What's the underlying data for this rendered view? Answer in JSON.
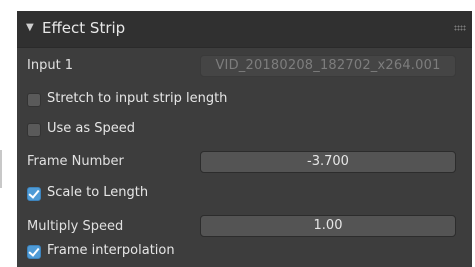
{
  "panel": {
    "title": "Effect Strip",
    "collapse_icon": "triangle-down-icon",
    "grip_icon": "drag-grip-icon"
  },
  "input1": {
    "label": "Input 1",
    "value": "VID_20180208_182702_x264.001"
  },
  "stretch": {
    "label": "Stretch to input strip length",
    "checked": false
  },
  "use_as_speed": {
    "label": "Use as Speed",
    "checked": false
  },
  "frame_number": {
    "label": "Frame Number",
    "value": "-3.700"
  },
  "scale_to_length": {
    "label": "Scale to Length",
    "checked": true
  },
  "multiply_speed": {
    "label": "Multiply Speed",
    "value": "1.00"
  },
  "frame_interpolation": {
    "label": "Frame interpolation",
    "checked": true
  },
  "colors": {
    "panel_bg": "#3d3d3d",
    "header_bg": "#303030",
    "checkbox_on": "#4f9bd6"
  }
}
